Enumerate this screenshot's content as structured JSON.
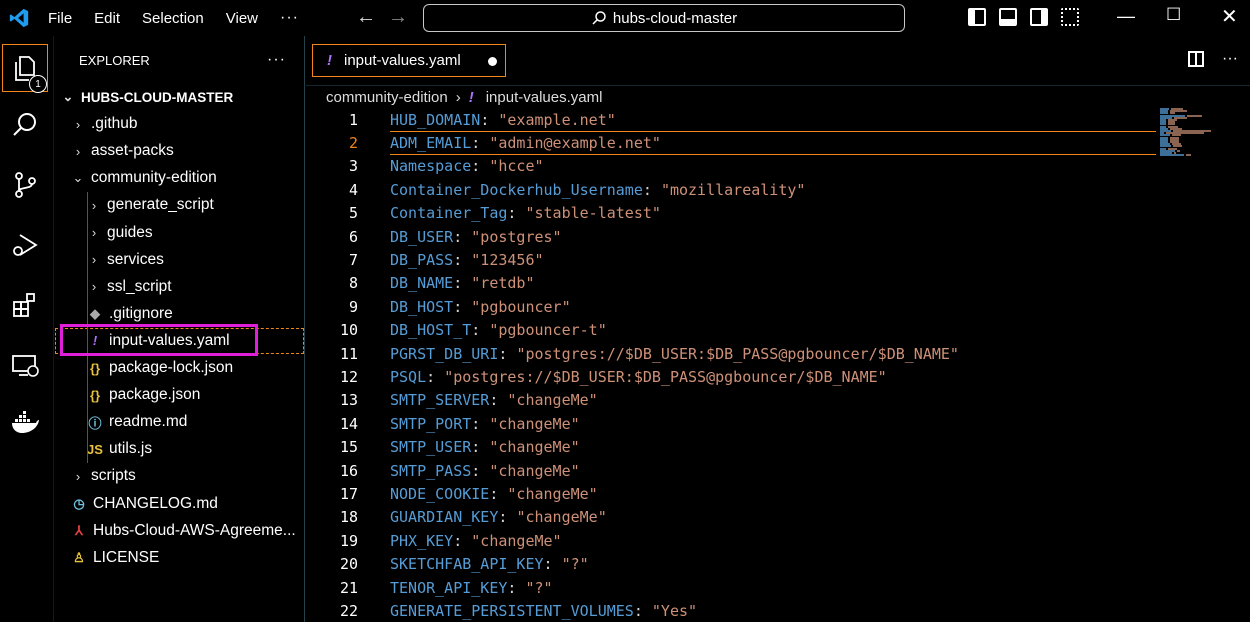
{
  "menu": [
    "File",
    "Edit",
    "Selection",
    "View",
    "···"
  ],
  "title_search": "hubs-cloud-master",
  "explorer": {
    "title": "EXPLORER",
    "more": "···",
    "badge": "1",
    "items": [
      {
        "label": "HUBS-CLOUD-MASTER",
        "chevron": "⌄",
        "icon": ""
      },
      {
        "label": ".github",
        "chevron": "›",
        "icon": ""
      },
      {
        "label": "asset-packs",
        "chevron": "›",
        "icon": ""
      },
      {
        "label": "community-edition",
        "chevron": "⌄",
        "icon": ""
      },
      {
        "label": "generate_script",
        "chevron": "›",
        "icon": ""
      },
      {
        "label": "guides",
        "chevron": "›",
        "icon": ""
      },
      {
        "label": "services",
        "chevron": "›",
        "icon": ""
      },
      {
        "label": "ssl_script",
        "chevron": "›",
        "icon": ""
      },
      {
        "label": ".gitignore",
        "chevron": "",
        "icon": "◆"
      },
      {
        "label": "input-values.yaml",
        "chevron": "",
        "icon": "!"
      },
      {
        "label": "package-lock.json",
        "chevron": "",
        "icon": "{}"
      },
      {
        "label": "package.json",
        "chevron": "",
        "icon": "{}"
      },
      {
        "label": "readme.md",
        "chevron": "",
        "icon": "ⓘ"
      },
      {
        "label": "utils.js",
        "chevron": "",
        "icon": "JS"
      },
      {
        "label": "scripts",
        "chevron": "›",
        "icon": ""
      },
      {
        "label": "CHANGELOG.md",
        "chevron": "",
        "icon": "◷"
      },
      {
        "label": "Hubs-Cloud-AWS-Agreeme...",
        "chevron": "",
        "icon": "⅄"
      },
      {
        "label": "LICENSE",
        "chevron": "",
        "icon": "♙"
      }
    ]
  },
  "tab": {
    "label": "input-values.yaml",
    "icon": "!"
  },
  "breadcrumb": {
    "folder": "community-edition",
    "sep": "›",
    "icon": "!",
    "file": "input-values.yaml"
  },
  "code": [
    {
      "n": "1",
      "key": "HUB_DOMAIN",
      "val": "\"example.net\""
    },
    {
      "n": "2",
      "key": "ADM_EMAIL",
      "val": "\"admin@example.net\""
    },
    {
      "n": "3",
      "key": "Namespace",
      "val": "\"hcce\""
    },
    {
      "n": "4",
      "key": "Container_Dockerhub_Username",
      "val": "\"mozillareality\""
    },
    {
      "n": "5",
      "key": "Container_Tag",
      "val": "\"stable-latest\""
    },
    {
      "n": "6",
      "key": "DB_USER",
      "val": "\"postgres\""
    },
    {
      "n": "7",
      "key": "DB_PASS",
      "val": "\"123456\""
    },
    {
      "n": "8",
      "key": "DB_NAME",
      "val": "\"retdb\""
    },
    {
      "n": "9",
      "key": "DB_HOST",
      "val": "\"pgbouncer\""
    },
    {
      "n": "10",
      "key": "DB_HOST_T",
      "val": "\"pgbouncer-t\""
    },
    {
      "n": "11",
      "key": "PGRST_DB_URI",
      "val": "\"postgres://$DB_USER:$DB_PASS@pgbouncer/$DB_NAME\""
    },
    {
      "n": "12",
      "key": "PSQL",
      "val": "\"postgres://$DB_USER:$DB_PASS@pgbouncer/$DB_NAME\""
    },
    {
      "n": "13",
      "key": "SMTP_SERVER",
      "val": "\"changeMe\""
    },
    {
      "n": "14",
      "key": "SMTP_PORT",
      "val": "\"changeMe\""
    },
    {
      "n": "15",
      "key": "SMTP_USER",
      "val": "\"changeMe\""
    },
    {
      "n": "16",
      "key": "SMTP_PASS",
      "val": "\"changeMe\""
    },
    {
      "n": "17",
      "key": "NODE_COOKIE",
      "val": "\"changeMe\""
    },
    {
      "n": "18",
      "key": "GUARDIAN_KEY",
      "val": "\"changeMe\""
    },
    {
      "n": "19",
      "key": "PHX_KEY",
      "val": "\"changeMe\""
    },
    {
      "n": "20",
      "key": "SKETCHFAB_API_KEY",
      "val": "\"?\""
    },
    {
      "n": "21",
      "key": "TENOR_API_KEY",
      "val": "\"?\""
    },
    {
      "n": "22",
      "key": "GENERATE_PERSISTENT_VOLUMES",
      "val": "\"Yes\""
    }
  ],
  "colors": {
    "accent": "#f38518",
    "key": "#569cd6",
    "string": "#ce9178",
    "highlight": "#e020d8",
    "yaml_icon": "#b070ff"
  }
}
